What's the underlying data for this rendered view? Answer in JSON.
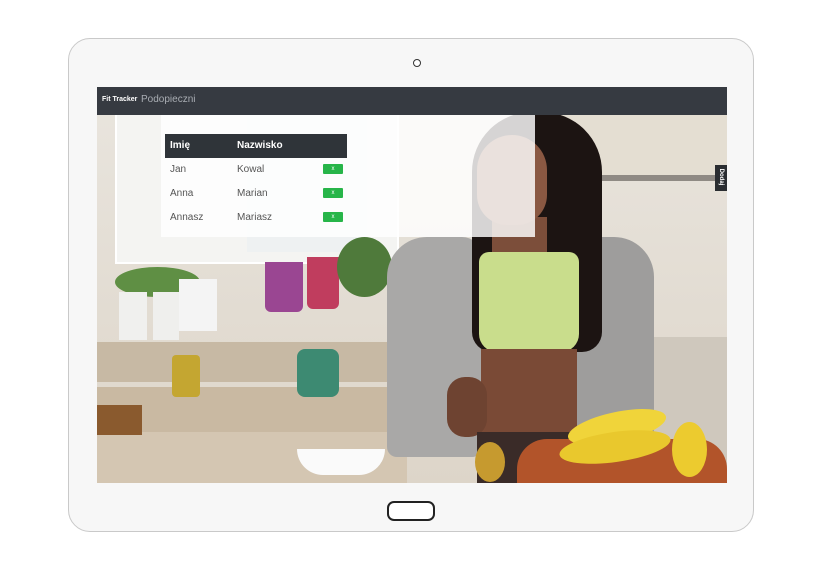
{
  "navbar": {
    "brand": "Fit Tracker",
    "link": "Podopieczni"
  },
  "table": {
    "headers": [
      "Imię",
      "Nazwisko"
    ],
    "rows": [
      {
        "first": "Jan",
        "last": "Kowal",
        "action": "x"
      },
      {
        "first": "Anna",
        "last": "Marian",
        "action": "x"
      },
      {
        "first": "Annasz",
        "last": "Mariasz",
        "action": "x"
      }
    ]
  },
  "side_button": {
    "label": "Dodaj"
  },
  "colors": {
    "navbar": "#363a41",
    "table_header": "#2f3439",
    "action_button": "#27b549"
  }
}
